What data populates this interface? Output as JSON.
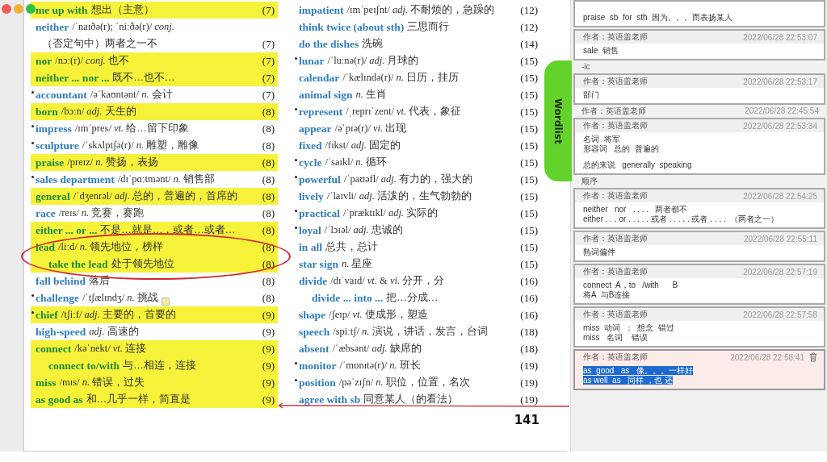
{
  "page": {
    "columns": [
      {
        "entries": [
          {
            "kind": "entry",
            "word": "me up with",
            "gloss": "想出（主意）",
            "page": "(7)",
            "bullet": false,
            "highlighted": true
          },
          {
            "kind": "entry",
            "word": "neither",
            "gloss": "/ˈnaɪðə(r); ˈniːðə(r)/ *conj.*",
            "continuation": "（否定句中）两者之一不",
            "page": "(7)",
            "bullet": false,
            "highlighted": false
          },
          {
            "kind": "entry",
            "word": "nor",
            "gloss": "/nɔː(r)/ *conj.* 也不",
            "page": "(7)",
            "bullet": false,
            "highlighted": true
          },
          {
            "kind": "entry",
            "word": "neither ... nor ...",
            "gloss": "既不…也不…",
            "page": "(7)",
            "bullet": false,
            "highlighted": true
          },
          {
            "kind": "entry",
            "word": "accountant",
            "gloss": "/əˈkaʊntənt/ *n.* 会计",
            "page": "(7)",
            "bullet": true,
            "highlighted": false
          },
          {
            "kind": "entry",
            "word": "born",
            "gloss": "/bɔːn/ *adj.* 天生的",
            "page": "(8)",
            "bullet": false,
            "highlighted": true
          },
          {
            "kind": "entry",
            "word": "impress",
            "gloss": "/ɪmˈpres/ *vt.* 给…留下印象",
            "page": "(8)",
            "bullet": true,
            "highlighted": false
          },
          {
            "kind": "entry",
            "word": "sculpture",
            "gloss": "/ˈskʌlptʃə(r)/ *n.* 雕塑，雕像",
            "page": "(8)",
            "bullet": true,
            "highlighted": false
          },
          {
            "kind": "entry",
            "word": "praise",
            "gloss": "/preɪz/ *n.* 赞扬，表扬",
            "page": "(8)",
            "bullet": false,
            "highlighted": true
          },
          {
            "kind": "entry",
            "word": "sales department",
            "gloss": "/dɪˈpɑːtmənt/ *n.* 销售部",
            "page": "(8)",
            "bullet": true,
            "highlighted": false
          },
          {
            "kind": "entry",
            "word": "general",
            "gloss": "/ˈdʒenrəl/ *adj.* 总的，普遍的，首席的",
            "page": "(8)",
            "bullet": false,
            "highlighted": true
          },
          {
            "kind": "entry",
            "word": "race",
            "gloss": "/reɪs/ *n.* 竞赛，赛跑",
            "page": "(8)",
            "bullet": false,
            "highlighted": false
          },
          {
            "kind": "entry",
            "word": "either ... or ...",
            "gloss": "不是…就是…，或者…或者…",
            "page": "(8)",
            "bullet": false,
            "highlighted": true
          },
          {
            "kind": "circled",
            "entries": [
              {
                "kind": "entry",
                "word": "lead",
                "gloss": "/liːd/ *n.* 领先地位，榜样",
                "page": "(8)",
                "bullet": false,
                "highlighted": true,
                "children": [
                  {
                    "kind": "entry",
                    "word": "take the lead",
                    "gloss": "处于领先地位",
                    "page": "(8)",
                    "bullet": false,
                    "highlighted": true
                  }
                ]
              }
            ]
          },
          {
            "kind": "entry",
            "word": "fall behind",
            "gloss": "落后",
            "page": "(8)",
            "bullet": false,
            "highlighted": false
          },
          {
            "kind": "entry",
            "word": "challenge",
            "gloss": "/ˈtʃælɪndʒ/ *n.* 挑战",
            "page": "(8)",
            "bullet": true,
            "highlighted": false,
            "note": true
          },
          {
            "kind": "entry",
            "word": "chief",
            "gloss": "/tʃiːf/ *adj.* 主要的，首要的",
            "page": "(9)",
            "bullet": true,
            "highlighted": true
          },
          {
            "kind": "entry",
            "word": "high-speed",
            "gloss": "*adj.* 高速的",
            "page": "(9)",
            "bullet": false,
            "highlighted": false
          },
          {
            "kind": "entry",
            "word": "connect",
            "gloss": "/kəˈnekt/ *vt.* 连接",
            "page": "(9)",
            "bullet": false,
            "highlighted": true,
            "children": [
              {
                "kind": "entry",
                "word": "connect to/with",
                "gloss": "与…相连，连接",
                "page": "(9)",
                "bullet": false,
                "highlighted": true
              }
            ]
          },
          {
            "kind": "entry",
            "word": "miss",
            "gloss": "/mɪs/ *n.* 错误，过失",
            "page": "(9)",
            "bullet": false,
            "highlighted": true
          },
          {
            "kind": "entry",
            "word": "as good as",
            "gloss": "和…几乎一样，简直是",
            "page": "(9)",
            "bullet": false,
            "highlighted": true
          }
        ]
      },
      {
        "entries": [
          {
            "kind": "entry",
            "word": "impatient",
            "gloss": "/ɪmˈpeɪʃnt/ *adj.* 不耐烦的，急躁的",
            "page": "(12)",
            "bullet": false,
            "highlighted": false
          },
          {
            "kind": "entry",
            "word": "think twice (about sth)",
            "gloss": "三思而行",
            "page": "(12)",
            "bullet": false,
            "highlighted": false
          },
          {
            "kind": "entry",
            "word": "do the dishes",
            "gloss": "洗碗",
            "page": "(14)",
            "bullet": false,
            "highlighted": false
          },
          {
            "kind": "entry",
            "word": "lunar",
            "gloss": "/ˈluːnə(r)/ *adj.* 月球的",
            "page": "(15)",
            "bullet": true,
            "highlighted": false
          },
          {
            "kind": "entry",
            "word": "calendar",
            "gloss": "/ˈkælɪndə(r)/ *n.* 日历，挂历",
            "page": "(15)",
            "bullet": false,
            "highlighted": false
          },
          {
            "kind": "entry",
            "word": "animal sign",
            "gloss": "*n.* 生肖",
            "page": "(15)",
            "bullet": false,
            "highlighted": false
          },
          {
            "kind": "entry",
            "word": "represent",
            "gloss": "/ˌreprɪˈzent/ *vt.* 代表，象征",
            "page": "(15)",
            "bullet": true,
            "highlighted": false
          },
          {
            "kind": "entry",
            "word": "appear",
            "gloss": "/əˈpɪə(r)/ *vi.* 出现",
            "page": "(15)",
            "bullet": false,
            "highlighted": false
          },
          {
            "kind": "entry",
            "word": "fixed",
            "gloss": "/fɪkst/ *adj.* 固定的",
            "page": "(15)",
            "bullet": false,
            "highlighted": false
          },
          {
            "kind": "entry",
            "word": "cycle",
            "gloss": "/ˈsaɪkl/ *n.* 循环",
            "page": "(15)",
            "bullet": true,
            "highlighted": false
          },
          {
            "kind": "entry",
            "word": "powerful",
            "gloss": "/ˈpaʊəfl/ *adj.* 有力的，强大的",
            "page": "(15)",
            "bullet": true,
            "highlighted": false
          },
          {
            "kind": "entry",
            "word": "lively",
            "gloss": "/ˈlaɪvli/ *adj.* 活泼的，生气勃勃的",
            "page": "(15)",
            "bullet": false,
            "highlighted": false
          },
          {
            "kind": "entry",
            "word": "practical",
            "gloss": "/ˈpræktɪkl/ *adj.* 实际的",
            "page": "(15)",
            "bullet": true,
            "highlighted": false
          },
          {
            "kind": "entry",
            "word": "loyal",
            "gloss": "/ˈlɔɪəl/ *adj.* 忠诚的",
            "page": "(15)",
            "bullet": true,
            "highlighted": false
          },
          {
            "kind": "entry",
            "word": "in all",
            "gloss": "总共，总计",
            "page": "(15)",
            "bullet": false,
            "highlighted": false
          },
          {
            "kind": "entry",
            "word": "star sign",
            "gloss": "*n.* 星座",
            "page": "(15)",
            "bullet": false,
            "highlighted": false
          },
          {
            "kind": "entry",
            "word": "divide",
            "gloss": "/dɪˈvaɪd/ *vt.* & *vi.* 分开，分",
            "page": "(16)",
            "bullet": false,
            "highlighted": false,
            "children": [
              {
                "kind": "entry",
                "word": "divide ... into ...",
                "gloss": "把…分成…",
                "page": "(16)",
                "bullet": false,
                "highlighted": false
              }
            ]
          },
          {
            "kind": "entry",
            "word": "shape",
            "gloss": "/ʃeɪp/ *vt.* 使成形，塑造",
            "page": "(16)",
            "bullet": false,
            "highlighted": false
          },
          {
            "kind": "entry",
            "word": "speech",
            "gloss": "/spiːtʃ/ *n.* 演说，讲话，发言，台词",
            "page": "(18)",
            "bullet": false,
            "highlighted": false
          },
          {
            "kind": "entry",
            "word": "absent",
            "gloss": "/ˈæbsənt/ *adj.* 缺席的",
            "page": "(18)",
            "bullet": false,
            "highlighted": false
          },
          {
            "kind": "entry",
            "word": "monitor",
            "gloss": "/ˈmɒnɪtə(r)/ *n.* 班长",
            "page": "(19)",
            "bullet": true,
            "highlighted": false
          },
          {
            "kind": "entry",
            "word": "position",
            "gloss": "/pəˈzɪʃn/ *n.* 职位，位置，名次",
            "page": "(19)",
            "bullet": true,
            "highlighted": false
          },
          {
            "kind": "entry",
            "word": "agree with sb",
            "gloss": "同意某人（的看法）",
            "page": "(19)",
            "bullet": false,
            "highlighted": false
          }
        ]
      }
    ],
    "page_number": "141",
    "side_tab": "Wordlist"
  },
  "annotations": [
    {
      "kind": "card",
      "paragraphs": [
        [
          "praise  sb  for  sth  因为。。。而表扬某人"
        ]
      ],
      "selected": false,
      "text_selected": false
    },
    {
      "kind": "card",
      "author": "作者：英语盖老师",
      "time": "2022/06/28 22:53:07",
      "paragraphs": [
        [
          "sale  销售"
        ]
      ],
      "selected": false,
      "text_selected": false
    },
    {
      "kind": "peek",
      "text": "-ic"
    },
    {
      "kind": "card",
      "author": "作者：英语盖老师",
      "time": "2022/06/28 22:53:17",
      "paragraphs": [
        [
          "部门"
        ]
      ],
      "selected": false,
      "text_selected": false
    },
    {
      "kind": "peek",
      "text": "作者：英语盖老师",
      "time": "2022/06/28 22:45:54"
    },
    {
      "kind": "card",
      "author": "作者：英语盖老师",
      "time": "2022/06/28 22:53:34",
      "paragraphs": [
        [
          "名词  将军",
          "形容词   总的  普遍的"
        ],
        [
          "总的来说   generally  speaking"
        ]
      ],
      "selected": false,
      "text_selected": false
    },
    {
      "kind": "peek",
      "text": "顺序"
    },
    {
      "kind": "card",
      "author": "作者：英语盖老师",
      "time": "2022/06/28 22:54:25",
      "paragraphs": [
        [
          "neither   nor   . . . .   两者都不",
          "either . . . or . . . . . 或者 . . . . . 或者 . . . .  （两者之一）"
        ]
      ],
      "selected": false,
      "text_selected": false
    },
    {
      "kind": "card",
      "author": "作者：英语盖老师",
      "time": "2022/06/28 22:55:11",
      "paragraphs": [
        [
          "熟词偏件"
        ]
      ],
      "selected": false,
      "text_selected": false
    },
    {
      "kind": "card",
      "author": "作者：英语盖老师",
      "time": "2022/06/28 22:57:19",
      "paragraphs": [
        [
          "connect  A，to   /with      B",
          "将A  与B连接"
        ]
      ],
      "selected": false,
      "text_selected": false
    },
    {
      "kind": "card",
      "author": "作者：英语盖老师",
      "time": "2022/06/28 22:57:58",
      "paragraphs": [
        [
          "miss  动词  ：  想念  错过",
          "miss   名词    错误"
        ]
      ],
      "selected": false,
      "text_selected": false
    },
    {
      "kind": "card",
      "author": "作者：英语盖老师",
      "time": "2022/06/28 22:58:41",
      "paragraphs": [
        [
          "as  good   as   像。。。一样好",
          "as well  as   同样 ，也 还"
        ]
      ],
      "selected": true,
      "text_selected": true
    }
  ]
}
